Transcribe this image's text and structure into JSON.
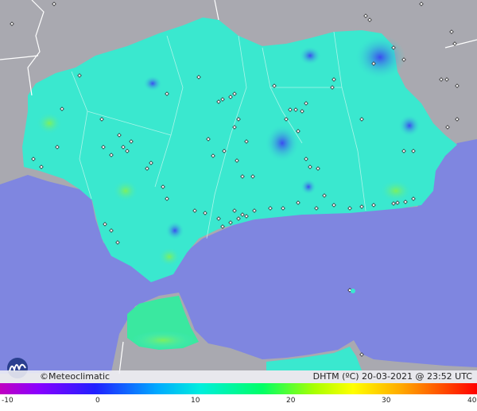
{
  "brand": {
    "name": "Meteoclimatic",
    "copyright_symbol": "©"
  },
  "map_caption": {
    "variable": "DHTM",
    "unit": "(ºC)",
    "date": "20-03-2021",
    "at": "@",
    "time": "23:52 UTC"
  },
  "legend": {
    "ticks": [
      "-10",
      "0",
      "10",
      "20",
      "30",
      "40"
    ],
    "min": -10,
    "max": 40,
    "colors": {
      "low": "#c000c0",
      "cold": "#2020ff",
      "cool": "#00ccff",
      "mild": "#00ff88",
      "warm": "#ffff00",
      "hot": "#ff0000"
    }
  },
  "map_colors": {
    "sea": "#7f86e0",
    "land_outside": "#a8a8ae",
    "region": "#3ae8cf",
    "border": "#ffffff"
  }
}
